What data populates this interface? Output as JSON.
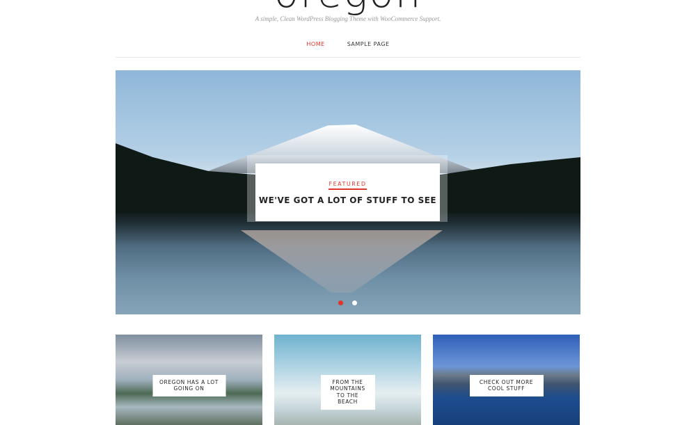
{
  "site": {
    "title": "oregon",
    "tagline": "A simple, Clean WordPress Blogging Theme with WooCommerce Support."
  },
  "nav": [
    {
      "label": "HOME",
      "active": true
    },
    {
      "label": "SAMPLE PAGE",
      "active": false
    }
  ],
  "hero": {
    "category": "FEATURED",
    "title": "WE'VE GOT A LOT OF STUFF TO SEE",
    "slides": 2,
    "active_slide": 1
  },
  "posts": [
    {
      "title": "OREGON HAS A LOT GOING ON"
    },
    {
      "title": "FROM THE MOUNTAINS TO THE BEACH"
    },
    {
      "title": "CHECK OUT MORE COOL STUFF"
    }
  ],
  "colors": {
    "accent": "#e0352b"
  }
}
